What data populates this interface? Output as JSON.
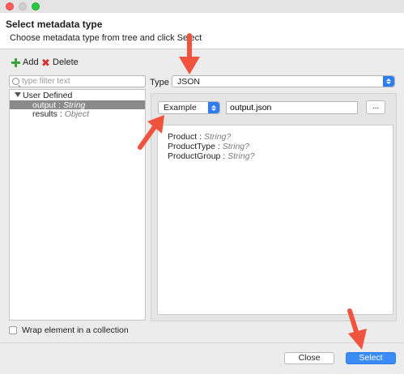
{
  "header": {
    "title": "Select metadata type",
    "subtitle": "Choose metadata type from tree and click Select"
  },
  "toolbar": {
    "add_label": "Add",
    "delete_label": "Delete"
  },
  "filter": {
    "placeholder": "type filter text",
    "value": ""
  },
  "tree": {
    "root": "User Defined",
    "items": [
      {
        "name": "output",
        "sep": " : ",
        "type": "String",
        "selected": true
      },
      {
        "name": "results",
        "sep": " : ",
        "type": "Object",
        "selected": false
      }
    ]
  },
  "type_field": {
    "label": "Type",
    "value": "JSON"
  },
  "mode_select": {
    "value": "Example"
  },
  "file_field": {
    "value": "output.json"
  },
  "browse_label": "...",
  "fields": [
    {
      "name": "Product",
      "sep": " : ",
      "type": "String?"
    },
    {
      "name": "ProductType",
      "sep": " : ",
      "type": "String?"
    },
    {
      "name": "ProductGroup",
      "sep": " : ",
      "type": "String?"
    }
  ],
  "wrap_checkbox": {
    "label": "Wrap element in a collection",
    "checked": false
  },
  "buttons": {
    "close": "Close",
    "select": "Select"
  },
  "colors": {
    "accent": "#3b8cf7",
    "annotation_arrow": "#f0533e",
    "selection": "#8a8a8a"
  }
}
